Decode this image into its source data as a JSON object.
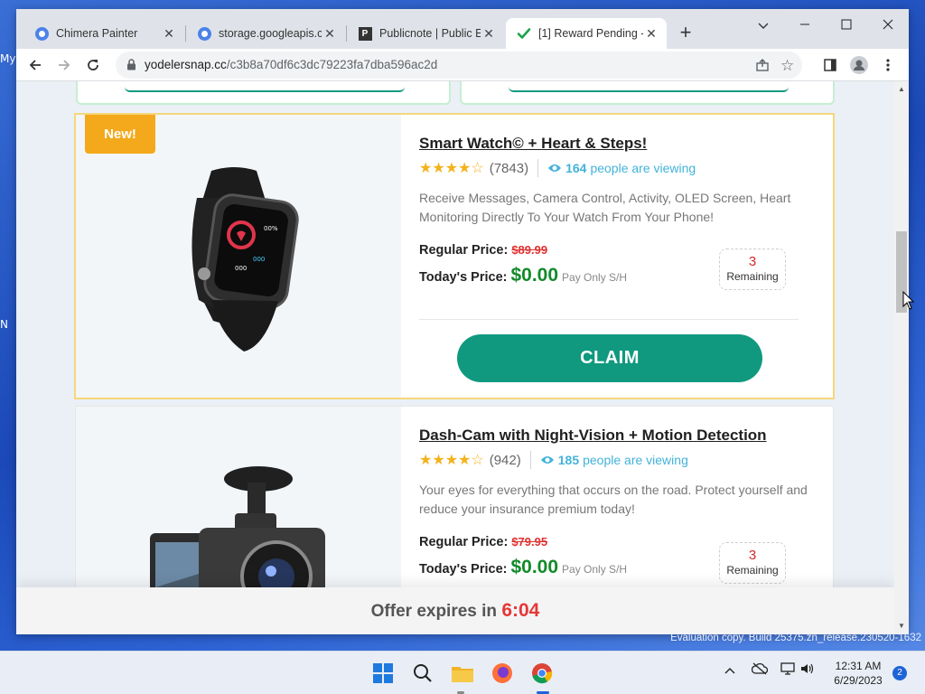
{
  "desktop": {
    "left_labels": [
      "My",
      "N"
    ],
    "watermark": "Evaluation copy. Build 25375.zn_release.230520-1632"
  },
  "tabs": [
    {
      "title": "Chimera Painter",
      "icon": "google-cloud-icon",
      "active": false
    },
    {
      "title": "storage.googleapis.c",
      "icon": "google-cloud-icon",
      "active": false
    },
    {
      "title": "Publicnote | Public E",
      "icon": "publicnote-icon",
      "active": false
    },
    {
      "title": "[1] Reward Pending -",
      "icon": "checkmark-icon",
      "active": true
    }
  ],
  "window_controls": {
    "chevron": "⌄",
    "minimize": "—",
    "maximize": "☐",
    "close": "✕"
  },
  "address_bar": {
    "host": "yodelersnap.cc",
    "path": "/c3b8a70df6c3dc79223fa7dba596ac2d"
  },
  "products": [
    {
      "badge": "New!",
      "title": "Smart Watch© + Heart & Steps!",
      "stars": "★★★★☆",
      "reviews": "(7843)",
      "viewers_count": "164",
      "viewers_text": "people are viewing",
      "description": "Receive Messages, Camera Control, Activity, OLED Screen, Heart Monitoring Directly To Your Watch From Your Phone!",
      "regular_label": "Regular Price:",
      "regular_price": "$89.99",
      "today_label": "Today's Price:",
      "today_price": "$0.00",
      "sh_note": "Pay Only S/H",
      "remaining_count": "3",
      "remaining_label": "Remaining",
      "claim_label": "CLAIM"
    },
    {
      "title": "Dash-Cam with Night-Vision + Motion Detection",
      "stars": "★★★★☆",
      "reviews": "(942)",
      "viewers_count": "185",
      "viewers_text": "people are viewing",
      "description": "Your eyes for everything that occurs on the road. Protect yourself and reduce your insurance premium today!",
      "regular_label": "Regular Price:",
      "regular_price": "$79.95",
      "today_label": "Today's Price:",
      "today_price": "$0.00",
      "sh_note": "Pay Only S/H",
      "remaining_count": "3",
      "remaining_label": "Remaining"
    }
  ],
  "offer": {
    "prefix": "Offer expires in",
    "timer": "6:04"
  },
  "taskbar": {
    "time": "12:31 AM",
    "date": "6/29/2023",
    "notifications": "2"
  },
  "colors": {
    "accent": "#10997f",
    "price_green": "#138a2b",
    "strike_red": "#e03131",
    "badge_orange": "#f3a91b",
    "viewers_blue": "#43b3d9"
  }
}
